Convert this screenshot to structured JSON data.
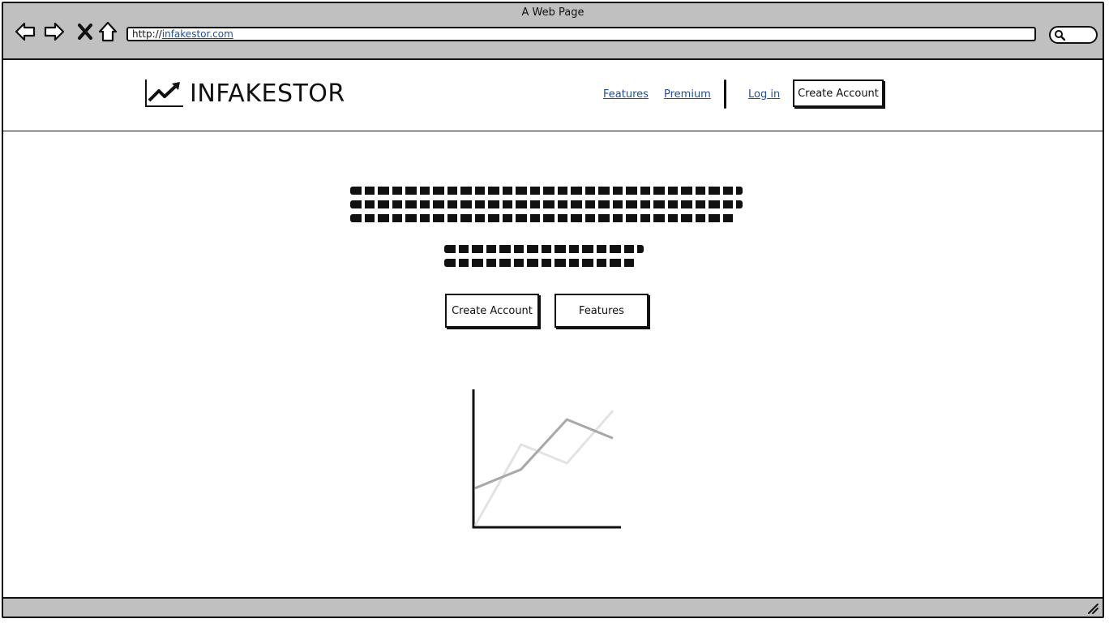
{
  "window": {
    "title": "A Web Page"
  },
  "browser": {
    "address": {
      "scheme": "http://",
      "host": "infakestor.com"
    },
    "icons": {
      "back": "arrow-left-icon",
      "forward": "arrow-right-icon",
      "stop": "close-icon",
      "home": "home-icon",
      "search": "search-icon"
    }
  },
  "header": {
    "logo_text": "INFAKESTOR",
    "nav": {
      "features": "Features",
      "premium": "Premium",
      "login": "Log in",
      "create_account": "Create Account"
    }
  },
  "hero": {
    "primary_button": "Create Account",
    "secondary_button": "Features"
  },
  "chart_data": {
    "type": "line",
    "series": [
      {
        "values": [
          [
            0,
            0.3
          ],
          [
            1,
            0.45
          ],
          [
            2,
            0.85
          ],
          [
            3,
            0.7
          ]
        ],
        "color": "#a8a8a8"
      },
      {
        "values": [
          [
            0,
            0.0
          ],
          [
            1,
            0.65
          ],
          [
            2,
            0.5
          ],
          [
            3,
            0.92
          ]
        ],
        "color": "#e3e3e3"
      }
    ],
    "xlim": [
      0,
      3
    ],
    "ylim": [
      0,
      1
    ]
  }
}
